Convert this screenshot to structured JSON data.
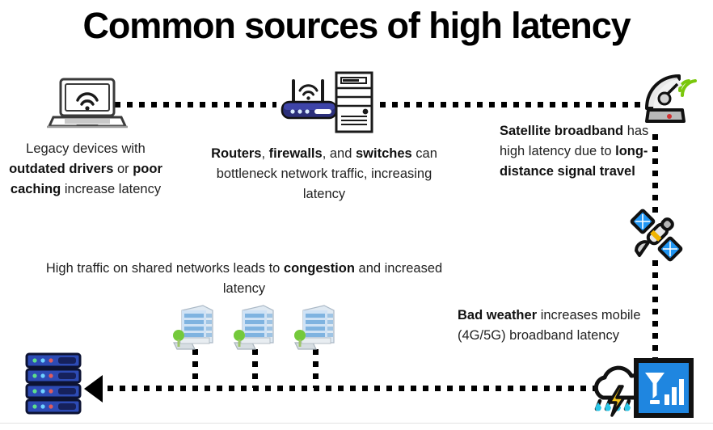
{
  "page": {
    "title": "Common sources of high latency",
    "accent_blue": "#1f86e0",
    "dot_color": "#000000",
    "text_color": "#222222"
  },
  "blocks": {
    "legacy": {
      "name": "legacy-devices-note",
      "parts": [
        {
          "text": "Legacy devices with ",
          "bold": false
        },
        {
          "text": "outdated drivers",
          "bold": true
        },
        {
          "text": " or ",
          "bold": false
        },
        {
          "text": "poor caching",
          "bold": true
        },
        {
          "text": " increase latency",
          "bold": false
        }
      ]
    },
    "routers": {
      "name": "routers-note",
      "parts": [
        {
          "text": "Routers",
          "bold": true
        },
        {
          "text": ", ",
          "bold": false
        },
        {
          "text": "firewalls",
          "bold": true
        },
        {
          "text": ", and ",
          "bold": false
        },
        {
          "text": "switches",
          "bold": true
        },
        {
          "text": " can bottleneck network traffic, increasing latency",
          "bold": false
        }
      ]
    },
    "satellite": {
      "name": "satellite-note",
      "parts": [
        {
          "text": "Satellite broadband",
          "bold": true
        },
        {
          "text": " has high latency due to ",
          "bold": false
        },
        {
          "text": "long-distance signal travel",
          "bold": true
        }
      ]
    },
    "congestion": {
      "name": "congestion-note",
      "parts": [
        {
          "text": "High traffic on shared networks leads to ",
          "bold": false
        },
        {
          "text": "congestion",
          "bold": true
        },
        {
          "text": " and increased latency",
          "bold": false
        }
      ]
    },
    "weather": {
      "name": "bad-weather-note",
      "parts": [
        {
          "text": "Bad weather",
          "bold": true
        },
        {
          "text": " increases mobile (4G/5G) broadband latency",
          "bold": false
        }
      ]
    }
  },
  "icons": [
    {
      "id": "laptop-wifi-icon",
      "label": "Laptop with Wi-Fi"
    },
    {
      "id": "router-wifi-icon",
      "label": "Wireless router"
    },
    {
      "id": "server-tower-icon",
      "label": "Server tower"
    },
    {
      "id": "satellite-dish-icon",
      "label": "Satellite dish"
    },
    {
      "id": "satellite-orbit-icon",
      "label": "Orbiting satellite"
    },
    {
      "id": "office-building-icon",
      "label": "Office building"
    },
    {
      "id": "storm-cloud-icon",
      "label": "Storm cloud with lightning and rain"
    },
    {
      "id": "mobile-signal-icon",
      "label": "Mobile signal strength"
    },
    {
      "id": "server-rack-icon",
      "label": "Server rack"
    },
    {
      "id": "arrow-left-icon",
      "label": "Flow arrow pointing left"
    }
  ]
}
